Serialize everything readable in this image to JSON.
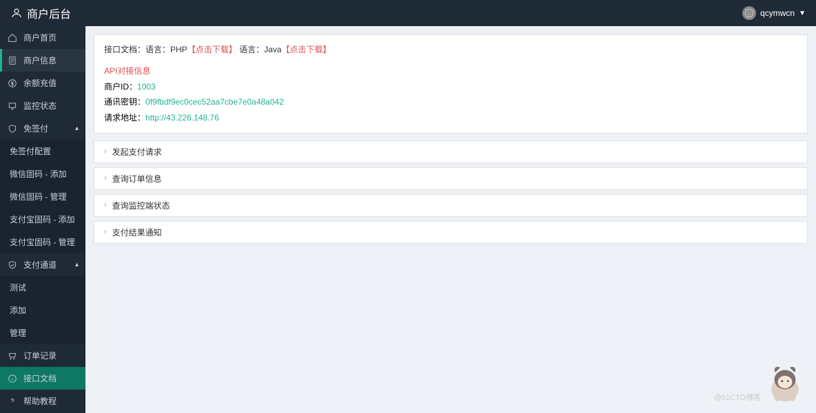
{
  "header": {
    "title": "商户后台",
    "username": "qcymwcn"
  },
  "sidebar": {
    "items": [
      {
        "label": "商户首页",
        "icon": "home"
      },
      {
        "label": "商户信息",
        "icon": "doc",
        "selected": true
      },
      {
        "label": "余额充值",
        "icon": "yen"
      },
      {
        "label": "监控状态",
        "icon": "monitor"
      },
      {
        "label": "免签付",
        "icon": "shield",
        "expand": true
      },
      {
        "label": "支付通道",
        "icon": "check-shield",
        "expand": true
      },
      {
        "label": "订单记录",
        "icon": "cart"
      },
      {
        "label": "接口文档",
        "icon": "info",
        "active": true
      },
      {
        "label": "帮助教程",
        "icon": "help"
      }
    ],
    "sub_miansign": [
      {
        "label": "免签付配置"
      },
      {
        "label": "微信固码 - 添加"
      },
      {
        "label": "微信固码 - 管理"
      },
      {
        "label": "支付宝固码 - 添加"
      },
      {
        "label": "支付宝固码 - 管理"
      }
    ],
    "sub_channel": [
      {
        "label": "测试"
      },
      {
        "label": "添加"
      },
      {
        "label": "管理"
      }
    ]
  },
  "main": {
    "doc_label": "接口文档：",
    "lang1_label": "语言：PHP",
    "lang1_link": "【点击下载】",
    "lang2_label": "语言：Java",
    "lang2_link": "【点击下载】",
    "api_title": "API对接信息",
    "merchant_id_label": "商户ID：",
    "merchant_id_value": "1003",
    "secret_label": "通讯密钥：",
    "secret_value": "0f9fbdf9ec0cec52aa7cbe7e0a48a042",
    "request_url_label": "请求地址：",
    "request_url_value": "http://43.226.148.76",
    "accordion": [
      {
        "title": "发起支付请求"
      },
      {
        "title": "查询订单信息"
      },
      {
        "title": "查询监控端状态"
      },
      {
        "title": "支付结果通知"
      }
    ]
  },
  "watermark": "@51CTO博客"
}
